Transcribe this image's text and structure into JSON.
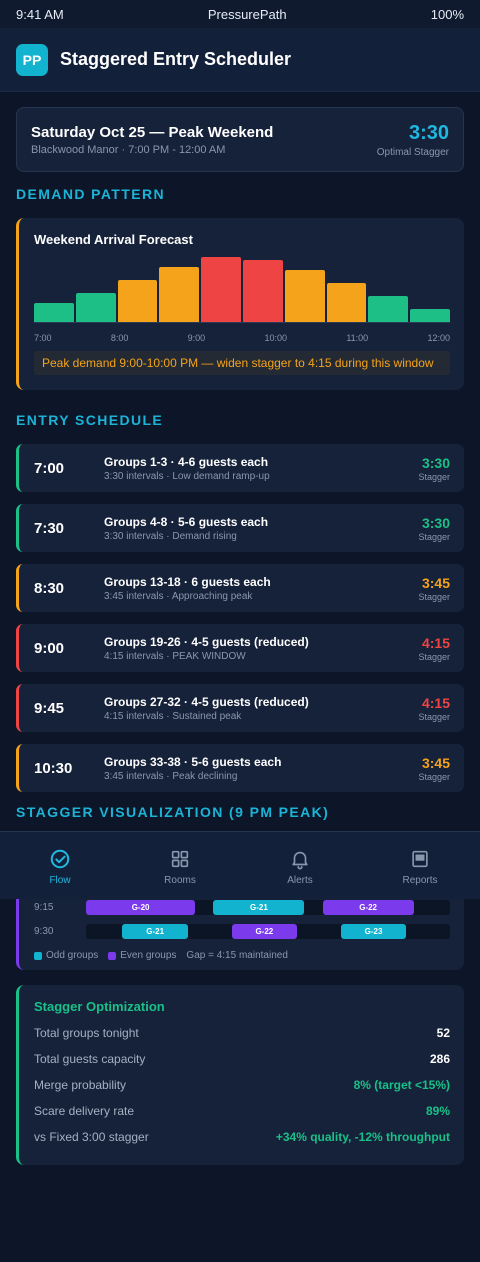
{
  "status": {
    "time": "9:41 AM",
    "carrier": "PressurePath",
    "battery": "100%"
  },
  "header": {
    "logo": "PP",
    "title": "Staggered Entry Scheduler"
  },
  "event": {
    "title": "Saturday Oct 25 — Peak Weekend",
    "subtitle": "Blackwood Manor · 7:00 PM - 12:00 AM",
    "stagger_value": "3:30",
    "stagger_label": "Optimal Stagger"
  },
  "sections": {
    "demand": "DEMAND PATTERN",
    "schedule": "ENTRY SCHEDULE",
    "visualization": "STAGGER VISUALIZATION (9 PM PEAK)"
  },
  "forecast": {
    "title": "Weekend Arrival Forecast",
    "note": "Peak demand 9:00-10:00 PM — widen stagger to 4:15 during this window"
  },
  "chart_data": {
    "type": "bar",
    "title": "Weekend Arrival Forecast",
    "x_ticks": [
      "7:00",
      "8:00",
      "9:00",
      "10:00",
      "11:00",
      "12:00"
    ],
    "values": [
      30,
      45,
      65,
      85,
      100,
      96,
      80,
      60,
      40,
      20
    ],
    "colors": [
      "#1dbf87",
      "#1dbf87",
      "#f5a31a",
      "#f5a31a",
      "#ef4444",
      "#ef4444",
      "#f5a31a",
      "#f5a31a",
      "#1dbf87",
      "#1dbf87"
    ],
    "ylim": [
      0,
      100
    ],
    "grid": false
  },
  "schedule": [
    {
      "time": "7:00",
      "groups": "Groups 1-3 · 4-6 guests each",
      "detail": "3:30 intervals · Low demand ramp-up",
      "stagger": "3:30",
      "label": "Stagger",
      "color": "#1dbf87"
    },
    {
      "time": "7:30",
      "groups": "Groups 4-8 · 5-6 guests each",
      "detail": "3:30 intervals · Demand rising",
      "stagger": "3:30",
      "label": "Stagger",
      "color": "#1dbf87"
    },
    {
      "time": "8:30",
      "groups": "Groups 13-18 · 6 guests each",
      "detail": "3:45 intervals · Approaching peak",
      "stagger": "3:45",
      "label": "Stagger",
      "color": "#f5a31a"
    },
    {
      "time": "9:00",
      "groups": "Groups 19-26 · 4-5 guests (reduced)",
      "detail": "4:15 intervals · PEAK WINDOW",
      "stagger": "4:15",
      "label": "Stagger",
      "color": "#ef4444"
    },
    {
      "time": "9:45",
      "groups": "Groups 27-32 · 4-5 guests (reduced)",
      "detail": "4:15 intervals · Sustained peak",
      "stagger": "4:15",
      "label": "Stagger",
      "color": "#ef4444"
    },
    {
      "time": "10:30",
      "groups": "Groups 33-38 · 5-6 guests each",
      "detail": "3:45 intervals · Peak declining",
      "stagger": "3:45",
      "label": "Stagger",
      "color": "#f5a31a"
    }
  ],
  "visualization": {
    "rows": [
      {
        "time": "9:15",
        "blocks": [
          {
            "label": "G-20",
            "kind": "even",
            "start": 0.0,
            "end": 0.3
          },
          {
            "label": "G-21",
            "kind": "odd",
            "start": 0.35,
            "end": 0.6
          },
          {
            "label": "G-22",
            "kind": "even",
            "start": 0.65,
            "end": 0.9
          }
        ]
      },
      {
        "time": "9:30",
        "blocks": [
          {
            "label": "G-21",
            "kind": "odd",
            "start": 0.1,
            "end": 0.28
          },
          {
            "label": "G-22",
            "kind": "even",
            "start": 0.4,
            "end": 0.58
          },
          {
            "label": "G-23",
            "kind": "odd",
            "start": 0.7,
            "end": 0.88
          }
        ]
      }
    ],
    "legend": {
      "odd": "Odd groups",
      "even": "Even groups",
      "gap": "Gap = 4:15 maintained"
    },
    "colors": {
      "odd": "#12b3cf",
      "even": "#7c3aed"
    }
  },
  "optimization": {
    "title": "Stagger Optimization",
    "rows": [
      {
        "label": "Total groups tonight",
        "value": "52",
        "color": "#ffffff"
      },
      {
        "label": "Total guests capacity",
        "value": "286",
        "color": "#ffffff"
      },
      {
        "label": "Merge probability",
        "value": "8% (target <15%)",
        "color": "#19c088"
      },
      {
        "label": "Scare delivery rate",
        "value": "89%",
        "color": "#19c088"
      },
      {
        "label": "vs Fixed 3:00 stagger",
        "value": "+34% quality, -12% throughput",
        "color": "#19c088"
      }
    ]
  },
  "nav": [
    {
      "label": "Flow",
      "icon": "check-circle-icon",
      "active": true
    },
    {
      "label": "Rooms",
      "icon": "grid-icon",
      "active": false
    },
    {
      "label": "Alerts",
      "icon": "bell-icon",
      "active": false
    },
    {
      "label": "Reports",
      "icon": "report-icon",
      "active": false
    }
  ],
  "nav_colors": {
    "active": "#20b8e0",
    "inactive": "#8a96ab"
  }
}
